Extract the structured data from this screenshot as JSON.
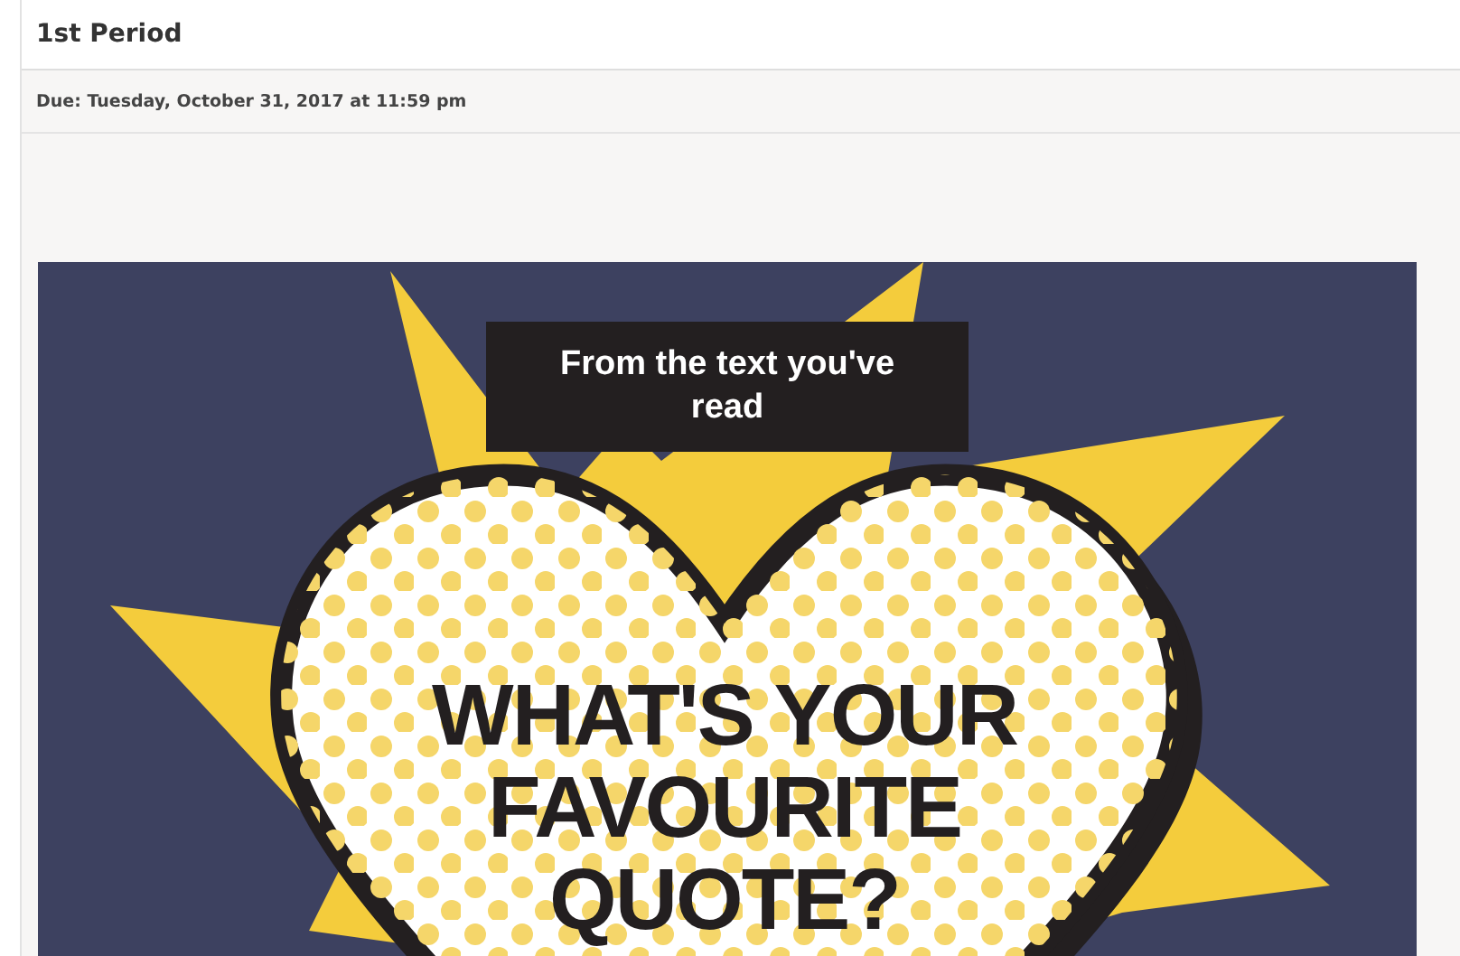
{
  "header": {
    "title": "1st Period"
  },
  "due": {
    "text": "Due: Tuesday, October 31, 2017 at 11:59 pm"
  },
  "poster": {
    "caption": "From the text you've read",
    "headline_lines": [
      "WHAT'S YOUR",
      "FAVOURITE",
      "QUOTE?"
    ]
  }
}
